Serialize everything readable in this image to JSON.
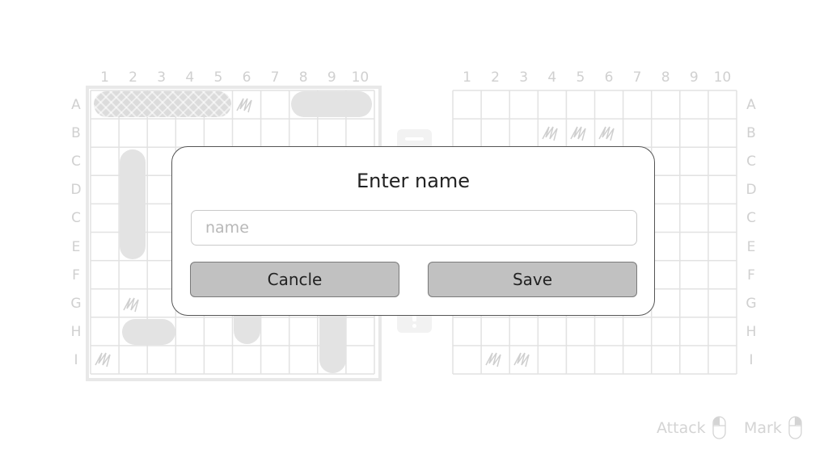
{
  "columns": [
    "1",
    "2",
    "3",
    "4",
    "5",
    "6",
    "7",
    "8",
    "9",
    "10"
  ],
  "left_rows": [
    "A",
    "B",
    "C",
    "D",
    "C",
    "E",
    "F",
    "G",
    "H",
    "I"
  ],
  "right_rows": [
    "A",
    "B",
    "C",
    "D",
    "C",
    "E",
    "F",
    "G",
    "H",
    "I"
  ],
  "colors": {
    "grid": "#e2e2e2",
    "label": "#d0d0d0",
    "ship": "#e3e3e3",
    "overlay_border": "#555555",
    "button_bg": "#c1c1c1"
  },
  "modal": {
    "title": "Enter name",
    "input_placeholder": "name",
    "input_value": "",
    "cancel_label": "Cancle",
    "save_label": "Save"
  },
  "hints": {
    "attack_label": "Attack",
    "mark_label": "Mark",
    "attack_icon": "mouse-left-icon",
    "mark_icon": "mouse-right-icon"
  }
}
